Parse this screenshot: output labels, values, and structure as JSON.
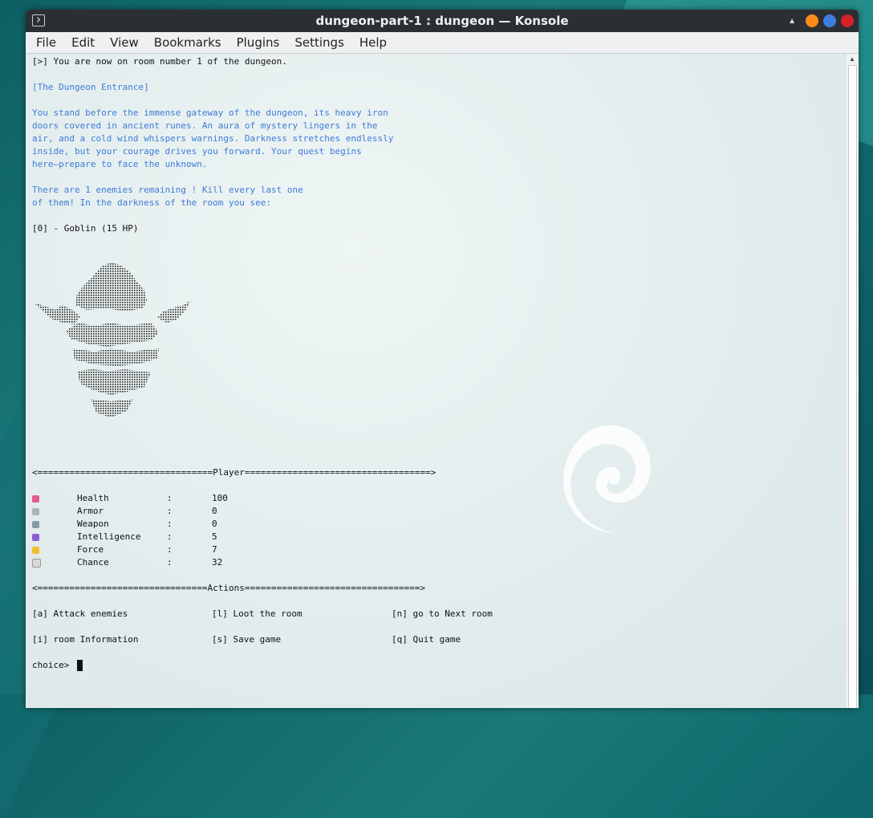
{
  "window": {
    "title": "dungeon-part-1 : dungeon — Konsole",
    "buttons": [
      "minimize",
      "maximize",
      "close"
    ],
    "colors": {
      "minimize": "#ff8c1a",
      "maximize": "#3d7de0",
      "close": "#d72124"
    }
  },
  "menu": [
    "File",
    "Edit",
    "View",
    "Bookmarks",
    "Plugins",
    "Settings",
    "Help"
  ],
  "terminal": {
    "room_line": "[>] You are now on room number 1 of the dungeon.",
    "room_name": "[The Dungeon Entrance]",
    "description": [
      "You stand before the immense gateway of the dungeon, its heavy iron",
      "doors covered in ancient runes. An aura of mystery lingers in the",
      "air, and a cold wind whispers warnings. Darkness stretches endlessly",
      "inside, but your courage drives you forward. Your quest begins",
      "here—prepare to face the unknown."
    ],
    "enemies_text": [
      "There are 1 enemies remaining ! Kill every last one",
      "of them! In the darkness of the room you see:"
    ],
    "enemy_list": [
      "[0] - Goblin (15 HP)"
    ],
    "player_header": "<=================================Player===================================>",
    "stats": [
      {
        "icon": "heart-icon",
        "name": "Health",
        "sep": ":",
        "value": "100"
      },
      {
        "icon": "shield-icon",
        "name": "Armor",
        "sep": ":",
        "value": "0"
      },
      {
        "icon": "sword-icon",
        "name": "Weapon",
        "sep": ":",
        "value": "0"
      },
      {
        "icon": "crystal-ball-icon",
        "name": "Intelligence",
        "sep": ":",
        "value": "5"
      },
      {
        "icon": "muscle-icon",
        "name": "Force",
        "sep": ":",
        "value": "7"
      },
      {
        "icon": "dice-icon",
        "name": "Chance",
        "sep": ":",
        "value": "32"
      }
    ],
    "actions_header": "<================================Actions=================================>",
    "actions": [
      "[a] Attack enemies",
      "[l] Loot the room",
      "[n] go to Next room",
      "[i] room Information",
      "[s] Save game",
      "[q] Quit game"
    ],
    "prompt": "choice>"
  },
  "colors": {
    "terminal_text": "#111111",
    "accent_text": "#3d7bd9"
  }
}
